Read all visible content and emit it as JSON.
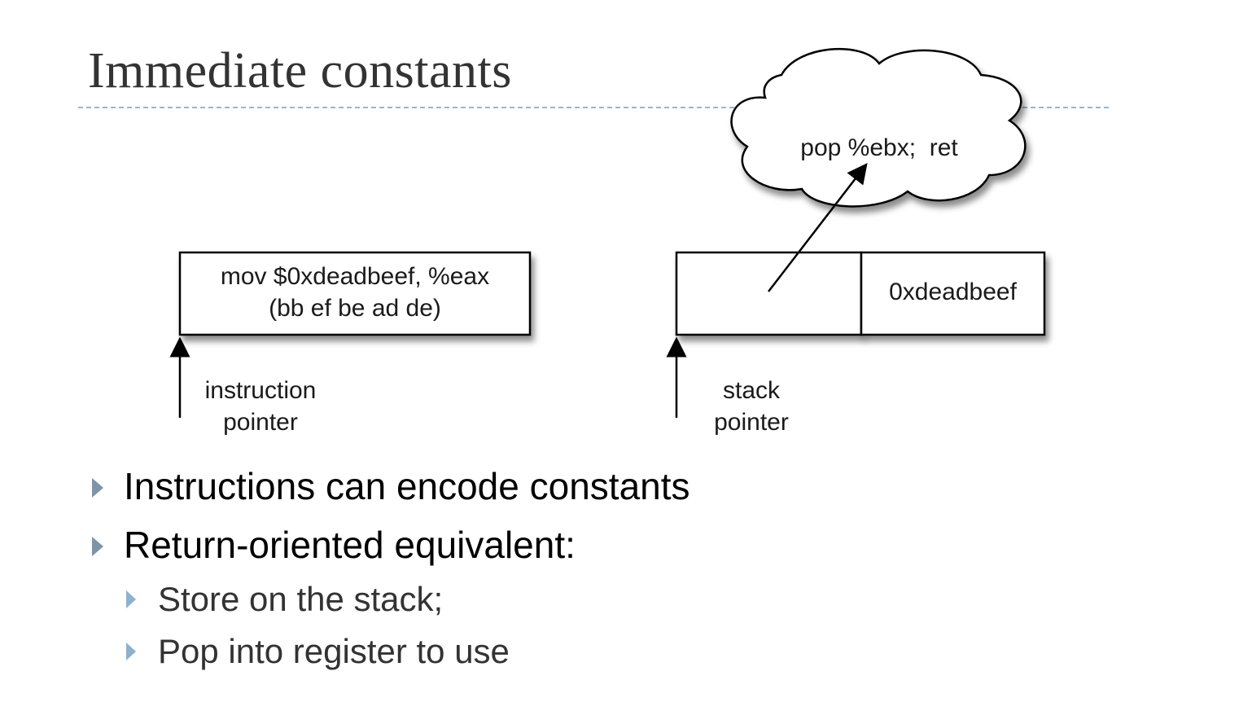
{
  "slide": {
    "title": "Immediate constants"
  },
  "diagram": {
    "instruction_box": {
      "line1": "mov $0xdeadbeef, %eax",
      "line2": "(bb ef be ad de)"
    },
    "instruction_pointer": {
      "line1": "instruction",
      "line2": "pointer"
    },
    "stack_cell_value": "0xdeadbeef",
    "stack_pointer": {
      "line1": "stack",
      "line2": "pointer"
    },
    "gadget_cloud": "pop %ebx;  ret"
  },
  "bullets": [
    {
      "text": "Instructions can encode constants",
      "children": []
    },
    {
      "text": "Return-oriented equivalent:",
      "children": [
        "Store on the stack;",
        "Pop into register to use"
      ]
    }
  ],
  "colors": {
    "title": "#333333",
    "rule": "#9ab4d0",
    "bullet_marker": "#7e95a8",
    "sub_bullet_marker": "#8fb1cc"
  }
}
